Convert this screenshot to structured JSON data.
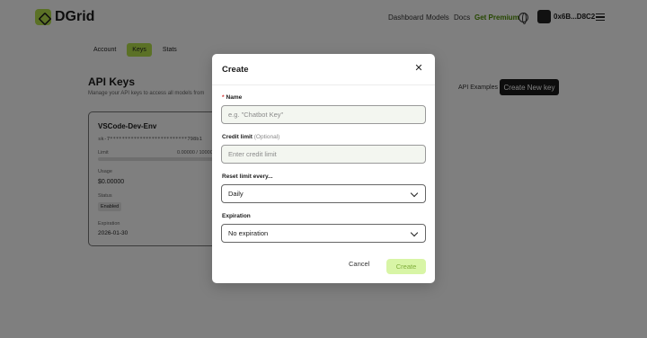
{
  "brand": {
    "name": "DGrid"
  },
  "nav": {
    "dashboard": "Dashboard",
    "models": "Models",
    "docs": "Docs",
    "premium": "Get Premium"
  },
  "wallet": {
    "address": "0x6B...D8C2"
  },
  "tabs": [
    "Account",
    "Keys",
    "Stats"
  ],
  "active_tab": "Keys",
  "page": {
    "title": "API Keys",
    "subtitle": "Manage your API keys to access all models from",
    "api_examples": "API Examples",
    "new_key_button": "Create New key"
  },
  "key_card": {
    "name": "VSCode-Dev-Env",
    "key_masked": "sk-7**************************798b1",
    "limit_label": "Limit",
    "limit_value": "0.00000 / 10000",
    "usage_label": "Usage",
    "usage_value": "$0.00000",
    "status_label": "Status",
    "status_value": "Enabled",
    "expiration_label": "Expiration",
    "expiration_value": "2026-01-30"
  },
  "modal": {
    "title": "Create",
    "close_icon": "close-icon",
    "name_label": "Name",
    "name_required_mark": "*",
    "name_placeholder": "e.g. \"Chatbot Key\"",
    "credit_label": "Credit limit",
    "credit_optional": "(Optional)",
    "credit_placeholder": "Enter credit limit",
    "reset_label": "Reset limit every...",
    "reset_value": "Daily",
    "expiration_label": "Expiration",
    "expiration_value": "No expiration",
    "cancel_label": "Cancel",
    "create_label": "Create"
  },
  "colors": {
    "accent": "#b6e34c",
    "create_disabled": "#d8f5a6",
    "premium": "#4c8f00"
  }
}
